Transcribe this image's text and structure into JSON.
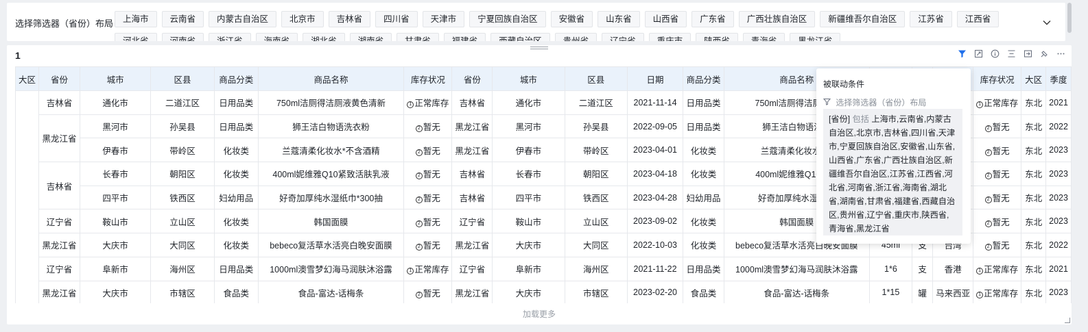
{
  "filter": {
    "label": "选择筛选器（省份）布局",
    "chips": [
      "上海市",
      "云南省",
      "内蒙古自治区",
      "北京市",
      "吉林省",
      "四川省",
      "天津市",
      "宁夏回族自治区",
      "安徽省",
      "山东省",
      "山西省",
      "广东省",
      "广西壮族自治区",
      "新疆维吾尔自治区",
      "江苏省",
      "江西省",
      "河北省",
      "河南省",
      "浙江省",
      "海南省",
      "湖北省",
      "湖南省",
      "甘肃省",
      "福建省",
      "西藏自治区",
      "贵州省",
      "辽宁省",
      "重庆市",
      "陕西省",
      "青海省",
      "黑龙江省"
    ],
    "expand_icon": "chevron-down-icon"
  },
  "table_card": {
    "title": "1",
    "load_more": "加载更多",
    "toolbar_icons": [
      "filter-icon",
      "fullscreen-icon",
      "info-icon",
      "align-icon",
      "export-icon",
      "link-icon",
      "more-icon"
    ]
  },
  "table": {
    "headers": [
      "大区",
      "省份",
      "城市",
      "区县",
      "商品分类",
      "商品名称",
      "库存状况",
      "省份",
      "城市",
      "区县",
      "日期",
      "商品分类",
      "商品名称",
      "",
      "",
      "",
      "库存状况",
      "大区",
      "季度"
    ],
    "rows": [
      {
        "prov": "吉林省",
        "city": "通化市",
        "dist": "二道江区",
        "cat": "日用品类",
        "name": "750ml洁厕得洁厕液黄色清新",
        "stock": "正常库存",
        "sc": "1",
        "prov2": "吉林省",
        "city2": "通化市",
        "dist2": "二道江区",
        "date": "2021-11-14",
        "cat2": "日用品类",
        "name2": "750ml洁厕得洁厕液黄",
        "spec": "",
        "unit": "",
        "origin": "",
        "stock2": "正常库存",
        "sc2": "1",
        "region": "东北",
        "q": "2021"
      },
      {
        "prov": "黑龙江省",
        "city": "黑河市",
        "dist": "孙吴县",
        "cat": "日用品类",
        "name": "狮王洁白物语洗衣粉",
        "stock": "暂无",
        "sc": "2",
        "prov2": "黑龙江省",
        "city2": "黑河市",
        "dist2": "孙吴县",
        "date": "2022-09-05",
        "cat2": "日用品类",
        "name2": "狮王洁白物语洗衣",
        "spec": "",
        "unit": "",
        "origin": "",
        "stock2": "暂无",
        "sc2": "2",
        "region": "东北",
        "q": "2022"
      },
      {
        "prov": "",
        "city": "伊春市",
        "dist": "带岭区",
        "cat": "化妆类",
        "name": "兰蔻清柔化妆水*不含酒精",
        "stock": "暂无",
        "sc": "2",
        "prov2": "黑龙江省",
        "city2": "伊春市",
        "dist2": "带岭区",
        "date": "2023-04-01",
        "cat2": "化妆类",
        "name2": "兰蔻清柔化妆水*不",
        "spec": "",
        "unit": "",
        "origin": "",
        "stock2": "暂无",
        "sc2": "2",
        "region": "东北",
        "q": "2023"
      },
      {
        "prov": "吉林省",
        "city": "长春市",
        "dist": "朝阳区",
        "cat": "化妆类",
        "name": "400ml妮维雅Q10紧致活肤乳液",
        "stock": "暂无",
        "sc": "2",
        "prov2": "吉林省",
        "city2": "长春市",
        "dist2": "朝阳区",
        "date": "2023-04-18",
        "cat2": "化妆类",
        "name2": "400ml妮维雅Q10紧致",
        "spec": "",
        "unit": "",
        "origin": "",
        "stock2": "暂无",
        "sc2": "2",
        "region": "东北",
        "q": "2023"
      },
      {
        "prov": "",
        "city": "四平市",
        "dist": "铁西区",
        "cat": "妇幼用品",
        "name": "好奇加厚纯水湿纸巾*300抽",
        "stock": "暂无",
        "sc": "2",
        "prov2": "吉林省",
        "city2": "四平市",
        "dist2": "铁西区",
        "date": "2023-04-28",
        "cat2": "妇幼用品",
        "name2": "好奇加厚纯水湿纸巾",
        "spec": "",
        "unit": "",
        "origin": "",
        "stock2": "暂无",
        "sc2": "2",
        "region": "东北",
        "q": "2023"
      },
      {
        "prov": "辽宁省",
        "city": "鞍山市",
        "dist": "立山区",
        "cat": "化妆类",
        "name": "韩国面膜",
        "stock": "暂无",
        "sc": "2",
        "prov2": "辽宁省",
        "city2": "鞍山市",
        "dist2": "立山区",
        "date": "2023-09-02",
        "cat2": "化妆类",
        "name2": "韩国面膜",
        "spec": "",
        "unit": "",
        "origin": "",
        "stock2": "暂无",
        "sc2": "2",
        "region": "东北",
        "q": "2023"
      },
      {
        "prov": "黑龙江省",
        "city": "大庆市",
        "dist": "大同区",
        "cat": "化妆类",
        "name": "bebeco复活草水活亮白晚安面膜",
        "stock": "暂无",
        "sc": "2",
        "prov2": "黑龙江省",
        "city2": "大庆市",
        "dist2": "大同区",
        "date": "2022-10-03",
        "cat2": "化妆类",
        "name2": "bebeco复活草水活亮白晚安面膜",
        "spec": "45ml",
        "unit": "支",
        "origin": "台湾",
        "stock2": "暂无",
        "sc2": "2",
        "region": "东北",
        "q": "2022"
      },
      {
        "prov": "辽宁省",
        "city": "阜新市",
        "dist": "海州区",
        "cat": "日用品类",
        "name": "1000ml澳雪梦幻海马润肤沐浴露",
        "stock": "正常库存",
        "sc": "1",
        "prov2": "辽宁省",
        "city2": "阜新市",
        "dist2": "海州区",
        "date": "2021-11-22",
        "cat2": "日用品类",
        "name2": "1000ml澳雪梦幻海马润肤沐浴露",
        "spec": "1*6",
        "unit": "支",
        "origin": "香港",
        "stock2": "正常库存",
        "sc2": "1",
        "region": "东北",
        "q": "2021"
      },
      {
        "prov": "黑龙江省",
        "city": "大庆市",
        "dist": "市辖区",
        "cat": "食品类",
        "name": "食品-富达-话梅条",
        "stock": "暂无",
        "sc": "2",
        "prov2": "黑龙江省",
        "city2": "大庆市",
        "dist2": "市辖区",
        "date": "2023-02-20",
        "cat2": "食品类",
        "name2": "食品-富达-话梅条",
        "spec": "1*15",
        "unit": "罐",
        "origin": "马来西亚",
        "stock2": "正常库存",
        "sc2": "1",
        "region": "东北",
        "q": "2023"
      }
    ]
  },
  "popover": {
    "title": "被联动条件",
    "source": "选择筛选器（省份）布局",
    "field": "[省份]",
    "op": "包括",
    "values": "上海市,云南省,内蒙古自治区,北京市,吉林省,四川省,天津市,宁夏回族自治区,安徽省,山东省,山西省,广东省,广西壮族自治区,新疆维吾尔自治区,江苏省,江西省,河北省,河南省,浙江省,海南省,湖北省,湖南省,甘肃省,福建省,西藏自治区,贵州省,辽宁省,重庆市,陕西省,青海省,黑龙江省"
  }
}
